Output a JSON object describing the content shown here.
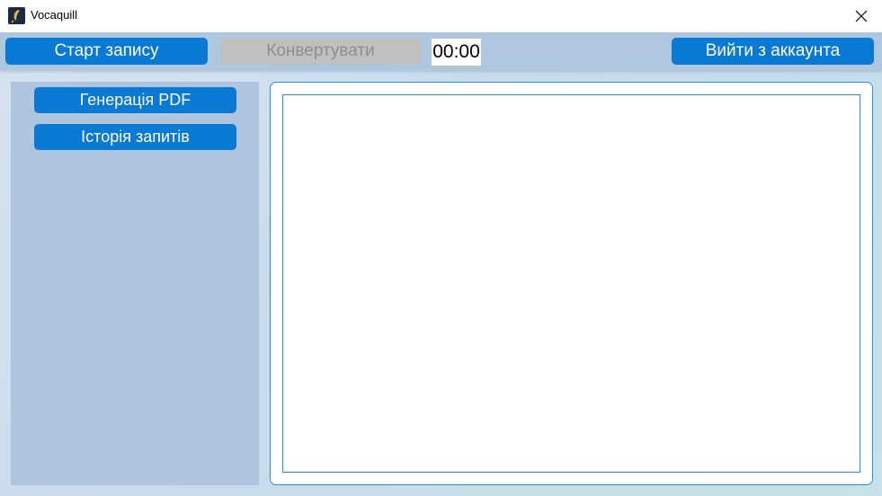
{
  "window": {
    "title": "Vocaquill",
    "close_symbol": "✕"
  },
  "toolbar": {
    "start_record_label": "Старт запису",
    "convert_label": "Конвертувати",
    "timer_value": "00:00",
    "logout_label": "Вийти з аккаунта"
  },
  "sidebar": {
    "items": [
      {
        "label": "Генерація PDF"
      },
      {
        "label": "Історія запитів"
      }
    ]
  },
  "colors": {
    "accent": "#0a79d4",
    "disabled": "#c0c0c0",
    "toolbar_bg": "#afc6df",
    "sidebar_bg": "#afc4de",
    "frame_border": "#2b8fd9"
  }
}
